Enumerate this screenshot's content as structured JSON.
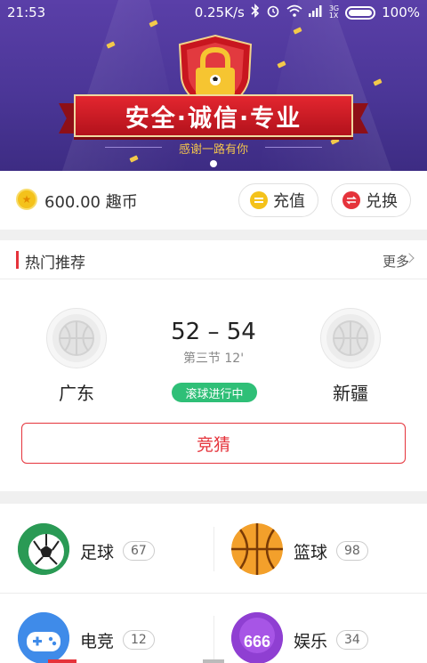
{
  "status_bar": {
    "time": "21:53",
    "speed": "0.25K/s",
    "network_top": "3G",
    "network_bottom": "1X",
    "battery": "100%"
  },
  "banner": {
    "headline": "安全·诚信·专业",
    "subtitle": "感谢一路有你"
  },
  "wallet": {
    "balance": "600.00 趣币",
    "recharge_label": "充值",
    "exchange_label": "兑换"
  },
  "hot": {
    "title": "热门推荐",
    "more_label": "更多",
    "match": {
      "home_team": "广东",
      "away_team": "新疆",
      "score": "52 – 54",
      "period": "第三节 12'",
      "live_status": "滚球进行中",
      "guess_label": "竞猜"
    }
  },
  "categories": [
    {
      "label": "足球",
      "count": "67"
    },
    {
      "label": "篮球",
      "count": "98"
    },
    {
      "label": "电竞",
      "count": "12"
    },
    {
      "label": "娱乐",
      "count": "34"
    }
  ],
  "entertainment_icon_text": "666",
  "colors": {
    "accent_red": "#e5333b",
    "live_green": "#2fbf77",
    "banner_purple": "#4b3697",
    "coin_gold": "#f4c21b"
  }
}
